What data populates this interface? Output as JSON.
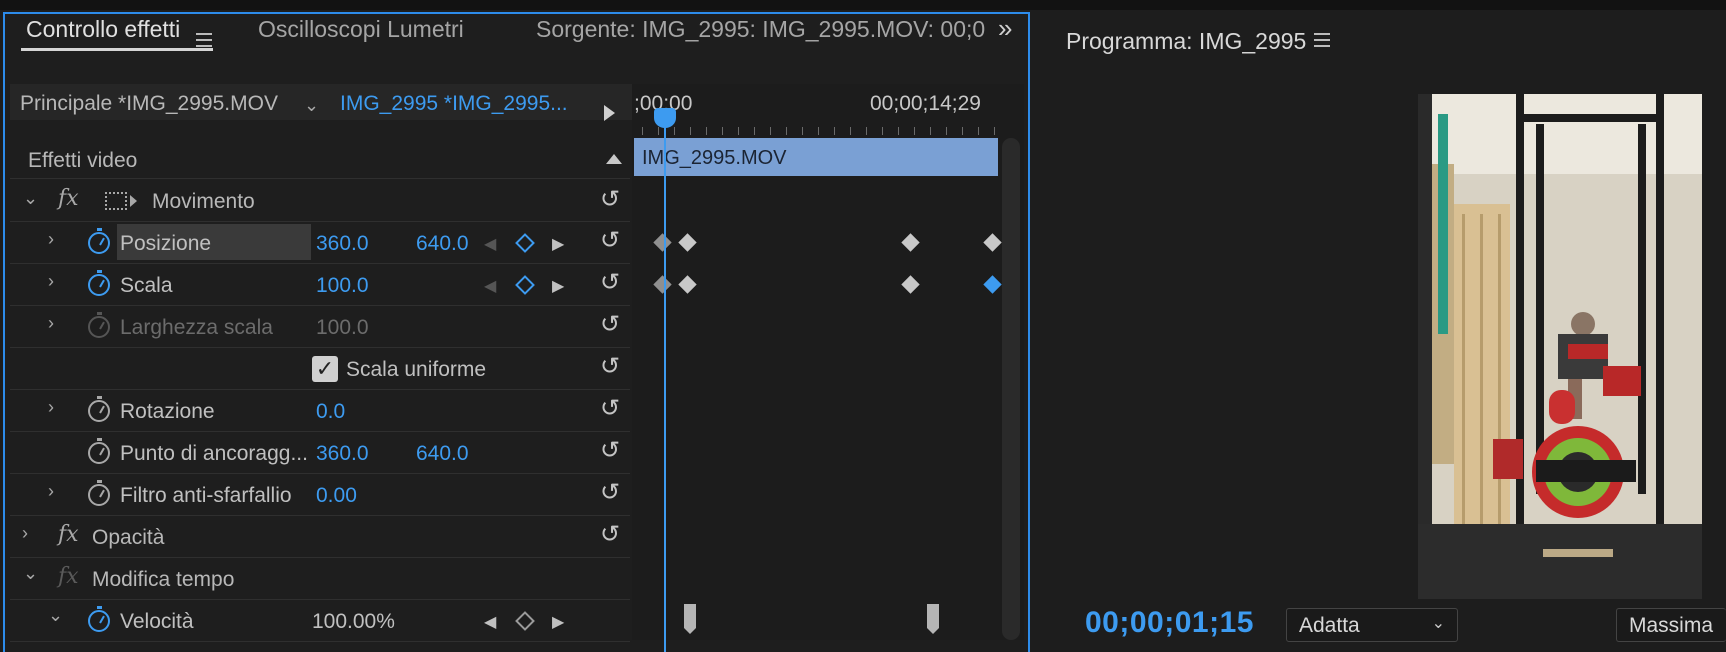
{
  "tabs": {
    "effect_controls": "Controllo effetti",
    "lumetri_scopes": "Oscilloscopi Lumetri",
    "source": "Sorgente: IMG_2995: IMG_2995.MOV: 00;0",
    "more": "»"
  },
  "subheader": {
    "master_clip": "Principale *IMG_2995.MOV",
    "sequence_clip": "IMG_2995 *IMG_2995...",
    "timecode_start": ";00;00",
    "timecode_end": "00;00;14;29",
    "clip_name": "IMG_2995.MOV"
  },
  "video_effects": {
    "title": "Effetti video"
  },
  "properties": {
    "motion": "Movimento",
    "position": {
      "label": "Posizione",
      "x": "360.0",
      "y": "640.0"
    },
    "scale": {
      "label": "Scala",
      "value": "100.0"
    },
    "scale_width": {
      "label": "Larghezza scala",
      "value": "100.0"
    },
    "uniform_scale": {
      "label": "Scala uniforme",
      "checked": true
    },
    "rotation": {
      "label": "Rotazione",
      "value": "0.0"
    },
    "anchor": {
      "label": "Punto di ancoragg...",
      "x": "360.0",
      "y": "640.0"
    },
    "flicker": {
      "label": "Filtro anti-sfarfallio",
      "value": "0.00"
    },
    "opacity": "Opacità",
    "time_remap": "Modifica tempo",
    "speed": {
      "label": "Velocità",
      "value": "100.00%"
    }
  },
  "program": {
    "title": "Programma: IMG_2995",
    "timecode": "00;00;01;15",
    "fit": "Adatta",
    "quality": "Massima"
  },
  "colors": {
    "accent": "#3d9bf0",
    "clip_bar": "#7aa0d4",
    "panel_border": "#2d8ceb"
  }
}
